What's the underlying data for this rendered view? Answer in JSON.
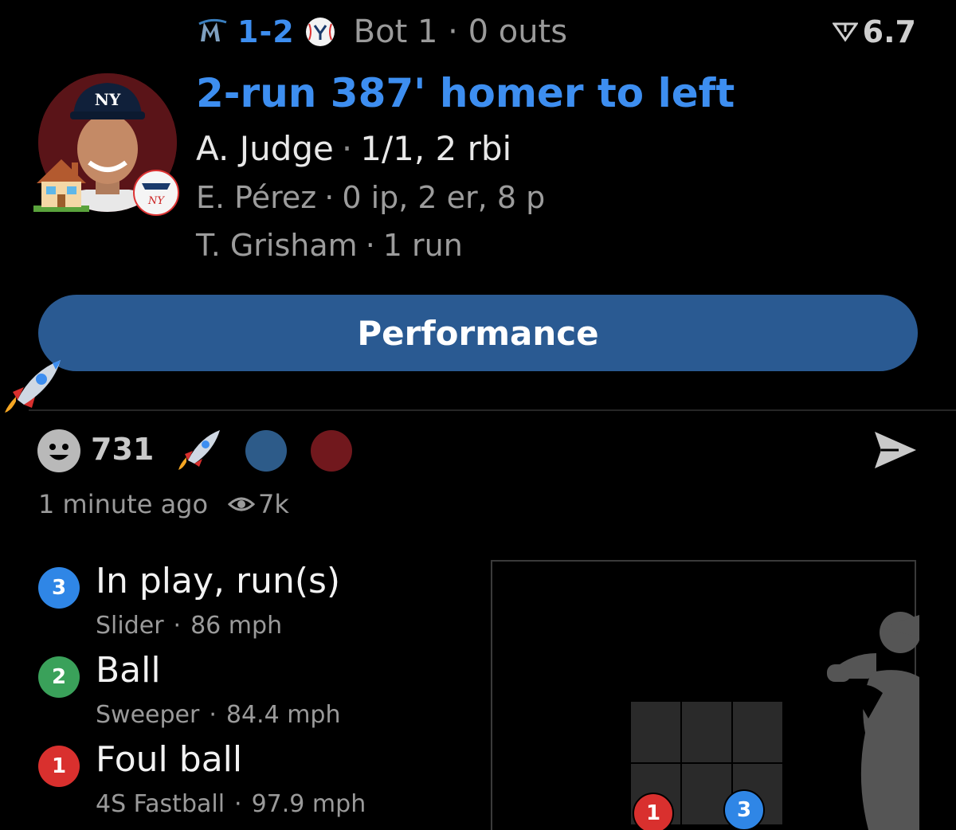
{
  "header": {
    "score": "1-2",
    "inning_status": "Bot 1 · 0 outs",
    "win_prob_value": "6.7",
    "icons": {
      "away_team": "marlins-logo-icon",
      "home_team": "yankees-logo-icon",
      "win_prob": "win-probability-icon"
    }
  },
  "play": {
    "headline": "2-run 387' homer to left",
    "batter": {
      "name": "A. Judge",
      "stats": "1/1, 2 rbi"
    },
    "pitcher": {
      "name": "E. Pérez",
      "stats": "0 ip, 2 er, 8 p"
    },
    "runner": {
      "name": "T. Grisham",
      "stats": "1 run"
    },
    "separator": "·"
  },
  "button": {
    "label": "Performance"
  },
  "reactions": {
    "count": "731",
    "time_ago": "1 minute ago",
    "views": "7k",
    "colors": {
      "blue_dot": "#2d5b89",
      "red_dot": "#71181d"
    }
  },
  "pitches": [
    {
      "number": "3",
      "result": "In play, run(s)",
      "type": "Slider",
      "speed": "86 mph",
      "color": "#2f86e6"
    },
    {
      "number": "2",
      "result": "Ball",
      "type": "Sweeper",
      "speed": "84.4 mph",
      "color": "#3aa15a"
    },
    {
      "number": "1",
      "result": "Foul ball",
      "type": "4S Fastball",
      "speed": "97.9 mph",
      "color": "#d9302e"
    }
  ],
  "zone_markers": [
    {
      "number": "1",
      "color": "#d9302e"
    },
    {
      "number": "3",
      "color": "#2f86e6"
    }
  ],
  "theme": {
    "accent": "#3d8ef0",
    "button": "#2a5a92",
    "background": "#000000"
  }
}
